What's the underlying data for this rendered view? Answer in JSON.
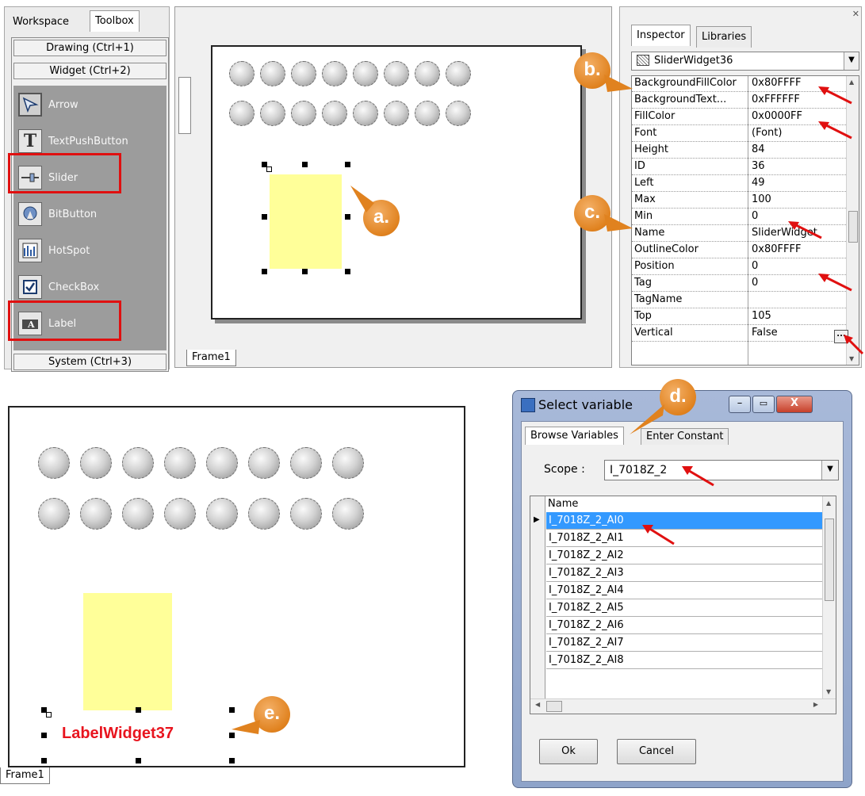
{
  "toolbox": {
    "tabs": [
      "Workspace",
      "Toolbox"
    ],
    "section_drawing": "Drawing (Ctrl+1)",
    "section_widget": "Widget (Ctrl+2)",
    "section_system": "System (Ctrl+3)",
    "items": [
      {
        "label": "Arrow",
        "icon": "arrow-icon"
      },
      {
        "label": "TextPushButton",
        "icon": "text-icon"
      },
      {
        "label": "Slider",
        "icon": "slider-icon"
      },
      {
        "label": "BitButton",
        "icon": "bitbutton-icon"
      },
      {
        "label": "HotSpot",
        "icon": "hotspot-icon"
      },
      {
        "label": "CheckBox",
        "icon": "checkbox-icon"
      },
      {
        "label": "Label",
        "icon": "label-icon"
      }
    ]
  },
  "canvas_top": {
    "frame_tab": "Frame1"
  },
  "canvas_bottom": {
    "frame_tab": "Frame1",
    "label_widget": "LabelWidget37"
  },
  "inspector": {
    "tabs": [
      "Inspector",
      "Libraries"
    ],
    "object": "SliderWidget36",
    "props": [
      {
        "name": "BackgroundFillColor",
        "value": "0x80FFFF"
      },
      {
        "name": "BackgroundText...",
        "value": "0xFFFFFF"
      },
      {
        "name": "FillColor",
        "value": "0x0000FF"
      },
      {
        "name": "Font",
        "value": "(Font)"
      },
      {
        "name": "Height",
        "value": "84"
      },
      {
        "name": "ID",
        "value": "36"
      },
      {
        "name": "Left",
        "value": "49"
      },
      {
        "name": "Max",
        "value": "100"
      },
      {
        "name": "Min",
        "value": "0"
      },
      {
        "name": "Name",
        "value": "SliderWidget"
      },
      {
        "name": "OutlineColor",
        "value": "0x80FFFF"
      },
      {
        "name": "Position",
        "value": "0"
      },
      {
        "name": "Tag",
        "value": "0"
      },
      {
        "name": "TagName",
        "value": ""
      },
      {
        "name": "Top",
        "value": "105"
      },
      {
        "name": "Vertical",
        "value": "False"
      }
    ],
    "ellipsis": "..."
  },
  "callouts": {
    "a": "a.",
    "b": "b.",
    "c": "c.",
    "d": "d.",
    "e": "e."
  },
  "dialog": {
    "title": "Select variable",
    "tabs": [
      "Browse Variables",
      "Enter Constant"
    ],
    "scope_label": "Scope :",
    "scope_value": "I_7018Z_2",
    "column_header": "Name",
    "rows": [
      "I_7018Z_2_AI0",
      "I_7018Z_2_AI1",
      "I_7018Z_2_AI2",
      "I_7018Z_2_AI3",
      "I_7018Z_2_AI4",
      "I_7018Z_2_AI5",
      "I_7018Z_2_AI6",
      "I_7018Z_2_AI7",
      "I_7018Z_2_AI8"
    ],
    "ok": "Ok",
    "cancel": "Cancel"
  },
  "colors": {
    "accent_orange": "#e0821f",
    "highlight_red": "#e01010",
    "label_red": "#e8141e",
    "selection_blue": "#3399ff",
    "slider_fill": "#ffff99"
  }
}
